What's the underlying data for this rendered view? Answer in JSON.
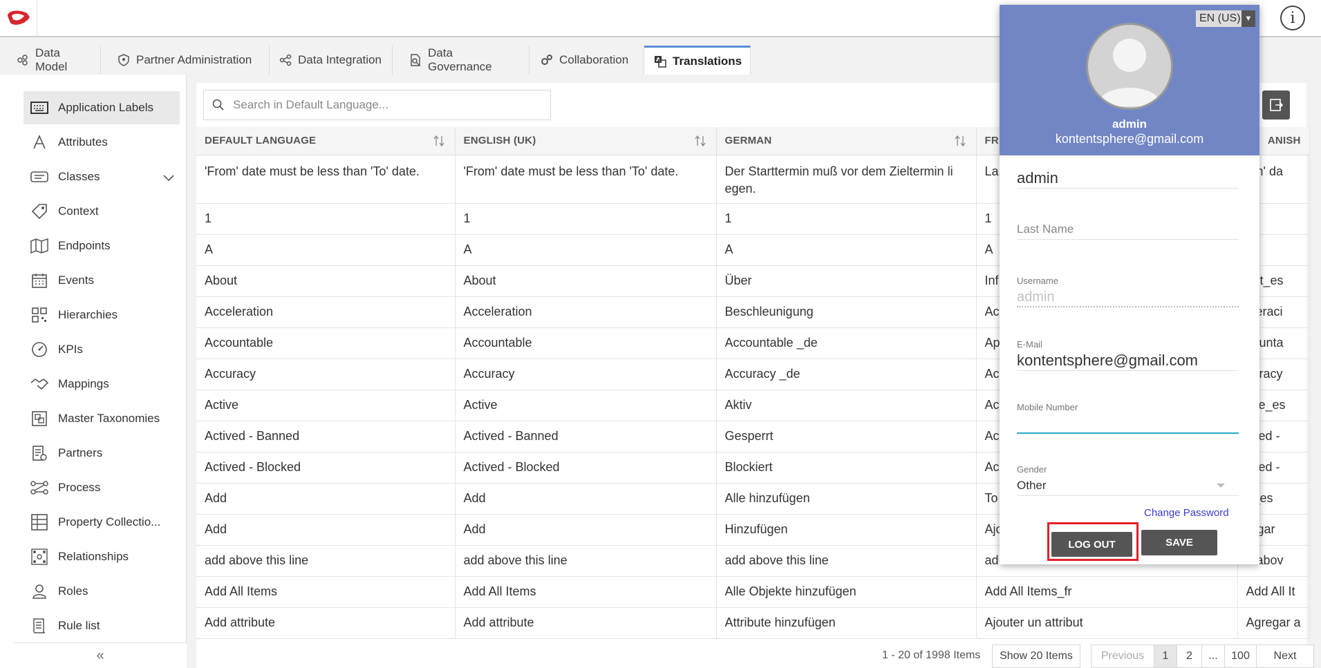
{
  "tabs": [
    {
      "label": "Data Model",
      "icon": "data-model-icon"
    },
    {
      "label": "Partner Administration",
      "icon": "shield-icon"
    },
    {
      "label": "Data Integration",
      "icon": "integration-icon"
    },
    {
      "label": "Data Governance",
      "icon": "governance-icon"
    },
    {
      "label": "Collaboration",
      "icon": "gears-icon"
    },
    {
      "label": "Translations",
      "icon": "translate-icon",
      "active": true
    }
  ],
  "sidebar": {
    "items": [
      {
        "label": "Application Labels",
        "icon": "keyboard-icon",
        "active": true
      },
      {
        "label": "Attributes",
        "icon": "letter-a-icon"
      },
      {
        "label": "Classes",
        "icon": "class-icon",
        "expandable": true
      },
      {
        "label": "Context",
        "icon": "tag-icon"
      },
      {
        "label": "Endpoints",
        "icon": "map-icon"
      },
      {
        "label": "Events",
        "icon": "calendar-icon"
      },
      {
        "label": "Hierarchies",
        "icon": "qr-icon"
      },
      {
        "label": "KPIs",
        "icon": "gauge-icon"
      },
      {
        "label": "Mappings",
        "icon": "handshake-icon"
      },
      {
        "label": "Master Taxonomies",
        "icon": "taxonomy-icon"
      },
      {
        "label": "Partners",
        "icon": "partners-icon"
      },
      {
        "label": "Process",
        "icon": "process-icon"
      },
      {
        "label": "Property Collectio...",
        "icon": "grid-icon"
      },
      {
        "label": "Relationships",
        "icon": "relationships-icon"
      },
      {
        "label": "Roles",
        "icon": "user-icon"
      },
      {
        "label": "Rule list",
        "icon": "scroll-icon"
      }
    ],
    "collapse_label": "«"
  },
  "search": {
    "placeholder": "Search in Default Language..."
  },
  "table": {
    "columns": [
      "DEFAULT LANGUAGE",
      "ENGLISH (UK)",
      "GERMAN",
      "FR",
      "ANISH"
    ],
    "rows": [
      [
        "'From' date must be less than 'To' date.",
        "'From' date must be less than 'To' date.",
        "Der Starttermin muß vor dem Zieltermin li egen.",
        "La e 'A",
        "om' da"
      ],
      [
        "1",
        "1",
        "1",
        "1",
        ""
      ],
      [
        "A",
        "A",
        "A",
        "A",
        ""
      ],
      [
        "About",
        "About",
        "Über",
        "Inf",
        "out_es"
      ],
      [
        "Acceleration",
        "Acceleration",
        "Beschleunigung",
        "Ac",
        "eleraci"
      ],
      [
        "Accountable",
        "Accountable",
        "Accountable _de",
        "Ap",
        "counta"
      ],
      [
        "Accuracy",
        "Accuracy",
        "Accuracy _de",
        "Ac",
        "curacy"
      ],
      [
        "Active",
        "Active",
        "Aktiv",
        "Ac",
        "tive_es"
      ],
      [
        "Actived - Banned",
        "Actived - Banned",
        "Gesperrt",
        "Ac",
        "tived -"
      ],
      [
        "Actived - Blocked",
        "Actived - Blocked",
        "Blockiert",
        "Ac",
        "tived -"
      ],
      [
        "Add",
        "Add",
        "Alle hinzufügen",
        "To",
        "d_es"
      ],
      [
        "Add",
        "Add",
        "Hinzufügen",
        "Ajo",
        "regar"
      ],
      [
        "add above this line",
        "add above this line",
        "add above this line",
        "ad",
        "d abov"
      ],
      [
        "Add All Items",
        "Add All Items",
        "Alle Objekte hinzufügen",
        "Add All Items_fr",
        "Add All It"
      ],
      [
        "Add attribute",
        "Add attribute",
        "Attribute hinzufügen",
        "Ajouter un attribut",
        "Agregar a"
      ]
    ]
  },
  "pagination": {
    "info": "1 - 20 of 1998 Items",
    "show": "Show 20 Items",
    "previous": "Previous",
    "pages": [
      "1",
      "2",
      "...",
      "100"
    ],
    "next": "Next"
  },
  "profile": {
    "language": "EN (US)",
    "name": "admin",
    "email": "kontentsphere@gmail.com",
    "first_name_value": "admin",
    "last_name_placeholder": "Last Name",
    "username_label": "Username",
    "username_value": "admin",
    "email_label": "E-Mail",
    "email_value": "kontentsphere@gmail.com",
    "mobile_label": "Mobile Number",
    "mobile_value": "",
    "gender_label": "Gender",
    "gender_value": "Other",
    "change_password": "Change Password",
    "logout": "LOG OUT",
    "save": "SAVE"
  },
  "colors": {
    "popup_header": "#7286c6",
    "accent": "#5a8ed6",
    "highlight": "#e0202a",
    "focus": "#26a9c8"
  }
}
